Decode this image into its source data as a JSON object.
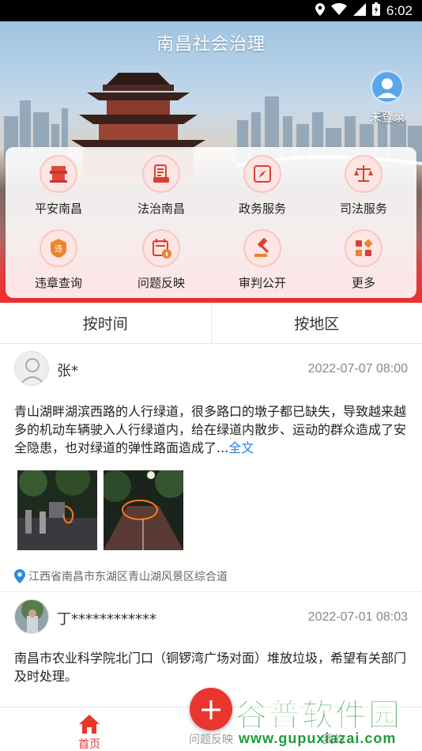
{
  "status_bar": {
    "time": "6:02"
  },
  "header": {
    "title": "南昌社会治理",
    "user_label": "未登录"
  },
  "menu": [
    {
      "label": "平安南昌",
      "icon": "safe-city-icon"
    },
    {
      "label": "法治南昌",
      "icon": "law-document-icon"
    },
    {
      "label": "政务服务",
      "icon": "compass-icon"
    },
    {
      "label": "司法服务",
      "icon": "scales-icon"
    },
    {
      "label": "违章查询",
      "icon": "violation-badge-icon"
    },
    {
      "label": "问题反映",
      "icon": "calendar-info-icon"
    },
    {
      "label": "审判公开",
      "icon": "gavel-icon"
    },
    {
      "label": "更多",
      "icon": "more-grid-icon"
    }
  ],
  "tabs": [
    {
      "label": "按时间"
    },
    {
      "label": "按地区"
    }
  ],
  "posts": [
    {
      "author": "张*",
      "time": "2022-07-07 08:00",
      "content": "青山湖畔湖滨西路的人行绿道，很多路口的墩子都已缺失，导致越来越多的机动车辆驶入人行绿道内，给在绿道内散步、运动的群众造成了安全隐患，也对绿道的弹性路面造成了...",
      "more_label": "全文",
      "location": "江西省南昌市东湖区青山湖风景区综合道"
    },
    {
      "author": "丁************",
      "time": "2022-07-01 08:03",
      "content": "南昌市农业科学院北门口（铜锣湾广场对面）堆放垃圾，希望有关部门及时处理。"
    }
  ],
  "bottom_nav": {
    "home_label": "首页",
    "report_label": "问题反映",
    "mine_label": "我的",
    "fab_symbol": "+"
  },
  "watermark": {
    "title": "谷普软件园",
    "url": "www.gupuxiazai.com"
  },
  "colors": {
    "accent": "#e8362e",
    "link": "#2f7ce0",
    "watermark": "#1e9c3a"
  }
}
